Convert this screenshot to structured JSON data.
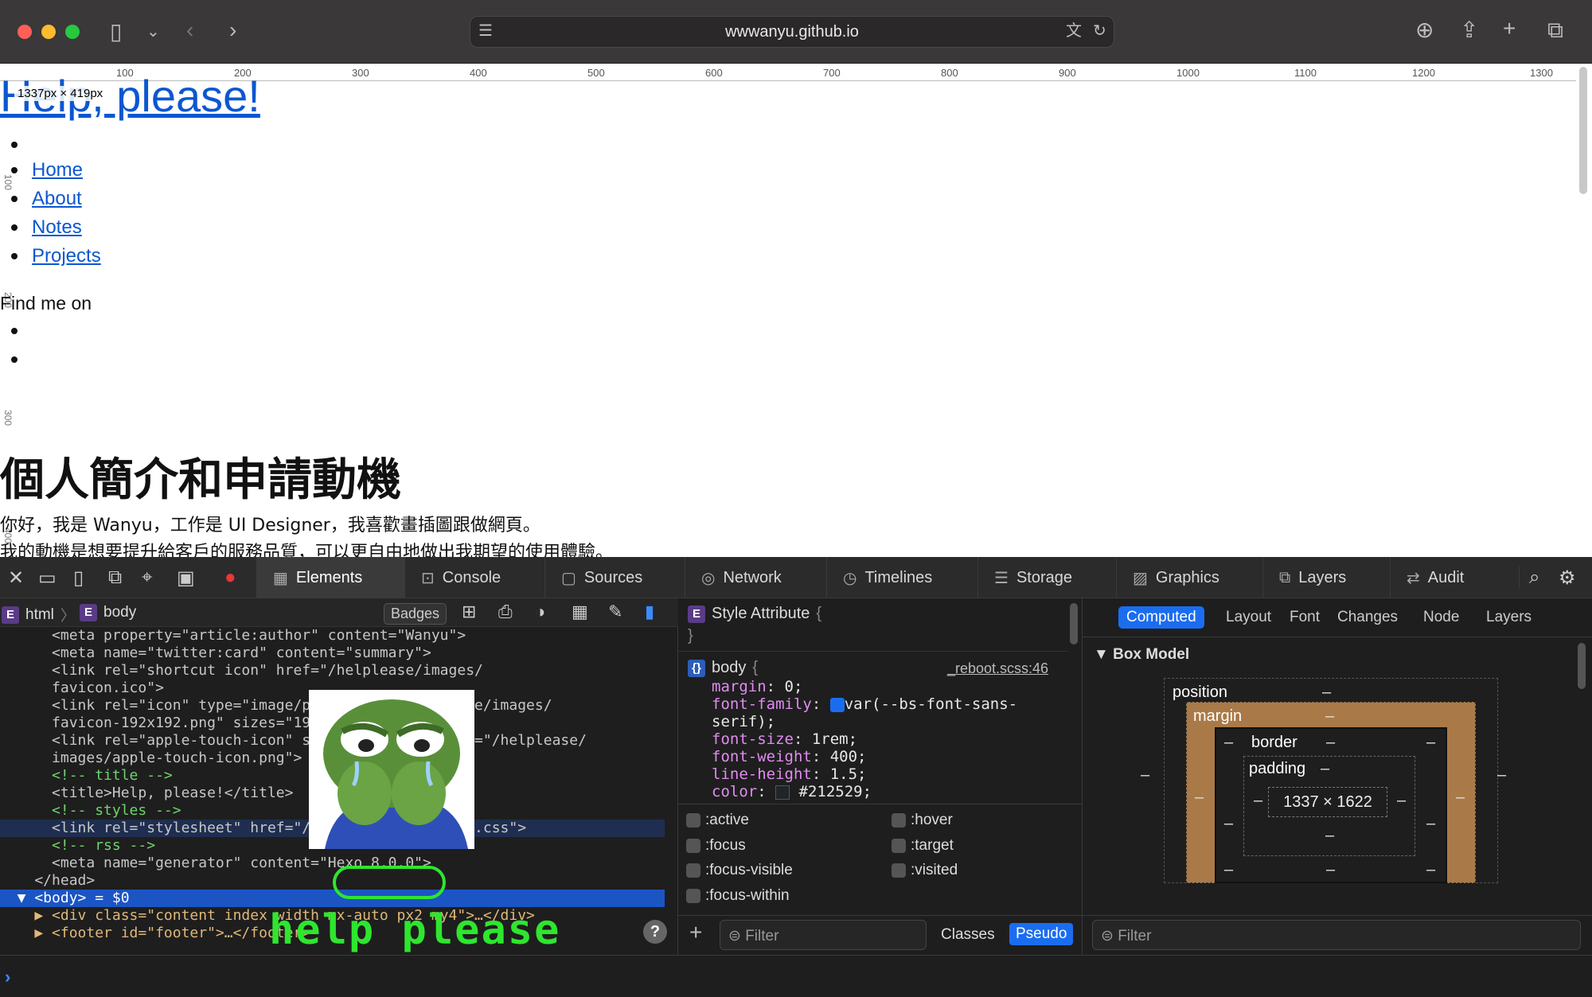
{
  "browser": {
    "url": "wwwanyu.github.io"
  },
  "page": {
    "ruler_h": [
      "100",
      "200",
      "300",
      "400",
      "500",
      "600",
      "700",
      "800",
      "900",
      "1000",
      "1100",
      "1200",
      "1300"
    ],
    "ruler_v": [
      "100",
      "200",
      "300",
      "400"
    ],
    "title": "Help, please!",
    "dimension_badge": "1337px × 419px",
    "nav": [
      "Home",
      "About",
      "Notes",
      "Projects"
    ],
    "find_me": "Find me on",
    "heading": "個人簡介和申請動機",
    "para1": "你好，我是 Wanyu，工作是 UI Designer，我喜歡畫插圖跟做網頁。",
    "para2": "我的動機是想要提升給客戶的服務品質，可以更自由地做出我期望的使用體驗。"
  },
  "devtools": {
    "tabs": [
      "Elements",
      "Console",
      "Sources",
      "Network",
      "Timelines",
      "Storage",
      "Graphics",
      "Layers",
      "Audit"
    ],
    "breadcrumb": [
      "html",
      "body"
    ],
    "badges_label": "Badges",
    "code_lines": [
      "      <meta property=\"article:author\" content=\"Wanyu\">",
      "      <meta name=\"twitter:card\" content=\"summary\">",
      "      <link rel=\"shortcut icon\" href=\"/helplease/images/",
      "      favicon.ico\">",
      "      <link rel=\"icon\" type=\"image/png\" href=\"/helplease/images/",
      "      favicon-192x192.png\" sizes=\"192x192\">",
      "      <link rel=\"apple-touch-icon\" sizes=\"180x180\" href=\"/helplease/",
      "      images/apple-touch-icon.png\">",
      "      <!-- title -->",
      "      <title>Help, please!</title>",
      "      <!-- styles -->",
      "      <link rel=\"stylesheet\" href=\"/helplease/css/style.css\">",
      "      <!-- rss -->",
      "      <meta name=\"generator\" content=\"Hexo 8.0.0\">",
      "    </head>",
      "  ▼ <body> = $0",
      "    ▶ <div class=\"content index width mx-auto px2 my4\">…</div>",
      "    ▶ <footer id=\"footer\">…</footer>"
    ],
    "overlay_text": "help please",
    "styles": {
      "style_attribute": "Style Attribute",
      "selector": "body",
      "source": "_reboot.scss:46",
      "props": [
        {
          "name": "margin",
          "value": "0;"
        },
        {
          "name": "font-family",
          "value": "var(--bs-font-sans-"
        },
        {
          "name": "",
          "value": "serif);"
        },
        {
          "name": "font-size",
          "value": "1rem;"
        },
        {
          "name": "font-weight",
          "value": "400;"
        },
        {
          "name": "line-height",
          "value": "1.5;"
        },
        {
          "name": "color",
          "value": "#212529;"
        }
      ],
      "pseudo": [
        ":active",
        ":hover",
        ":focus",
        ":target",
        ":focus-visible",
        ":visited",
        ":focus-within"
      ],
      "filter_placeholder": "Filter",
      "classes_label": "Classes",
      "pseudo_label": "Pseudo"
    },
    "computed": {
      "tabs": [
        "Computed",
        "Layout",
        "Font",
        "Changes",
        "Node",
        "Layers"
      ],
      "section": "Box Model",
      "position": "position",
      "margin": "margin",
      "border": "border",
      "padding": "padding",
      "content_size": "1337 × 1622",
      "dash": "–",
      "filter_placeholder": "Filter"
    }
  }
}
